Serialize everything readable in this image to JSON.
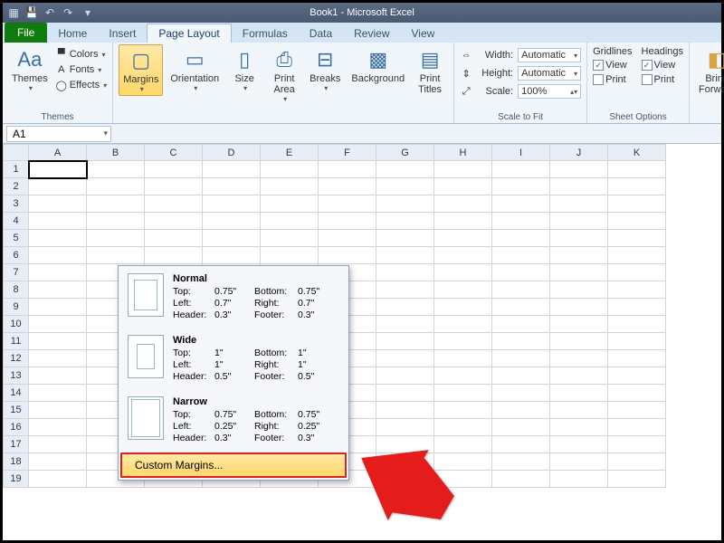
{
  "title": "Book1 - Microsoft Excel",
  "tabs": {
    "file": "File",
    "home": "Home",
    "insert": "Insert",
    "pageLayout": "Page Layout",
    "formulas": "Formulas",
    "data": "Data",
    "review": "Review",
    "view": "View"
  },
  "ribbon": {
    "themes": {
      "label": "Themes",
      "btn": "Themes",
      "colors": "Colors",
      "fonts": "Fonts",
      "effects": "Effects"
    },
    "margins": "Margins",
    "orientation": "Orientation",
    "size": "Size",
    "printArea": "Print\nArea",
    "breaks": "Breaks",
    "background": "Background",
    "printTitles": "Print\nTitles",
    "scale": {
      "label": "Scale to Fit",
      "width": "Width:",
      "widthVal": "Automatic",
      "height": "Height:",
      "heightVal": "Automatic",
      "scale": "Scale:",
      "scaleVal": "100%"
    },
    "sheet": {
      "label": "Sheet Options",
      "gridlines": "Gridlines",
      "headings": "Headings",
      "view": "View",
      "print": "Print",
      "gView": true,
      "gPrint": false,
      "hView": true,
      "hPrint": false
    },
    "bringForward": "Bring\nForward"
  },
  "namebox": "A1",
  "columns": [
    "A",
    "B",
    "C",
    "D",
    "E",
    "F",
    "G",
    "H",
    "I",
    "J",
    "K"
  ],
  "rows": [
    "1",
    "2",
    "3",
    "4",
    "5",
    "6",
    "7",
    "8",
    "9",
    "10",
    "11",
    "12",
    "13",
    "14",
    "15",
    "16",
    "17",
    "18",
    "19"
  ],
  "marginsMenu": {
    "normal": {
      "title": "Normal",
      "top": "Top:",
      "topV": "0.75\"",
      "bottom": "Bottom:",
      "bottomV": "0.75\"",
      "left": "Left:",
      "leftV": "0.7\"",
      "right": "Right:",
      "rightV": "0.7\"",
      "header": "Header:",
      "headerV": "0.3\"",
      "footer": "Footer:",
      "footerV": "0.3\""
    },
    "wide": {
      "title": "Wide",
      "top": "Top:",
      "topV": "1\"",
      "bottom": "Bottom:",
      "bottomV": "1\"",
      "left": "Left:",
      "leftV": "1\"",
      "right": "Right:",
      "rightV": "1\"",
      "header": "Header:",
      "headerV": "0.5\"",
      "footer": "Footer:",
      "footerV": "0.5\""
    },
    "narrow": {
      "title": "Narrow",
      "top": "Top:",
      "topV": "0.75\"",
      "bottom": "Bottom:",
      "bottomV": "0.75\"",
      "left": "Left:",
      "leftV": "0.25\"",
      "right": "Right:",
      "rightV": "0.25\"",
      "header": "Header:",
      "headerV": "0.3\"",
      "footer": "Footer:",
      "footerV": "0.3\""
    },
    "custom": "Custom Margins..."
  }
}
